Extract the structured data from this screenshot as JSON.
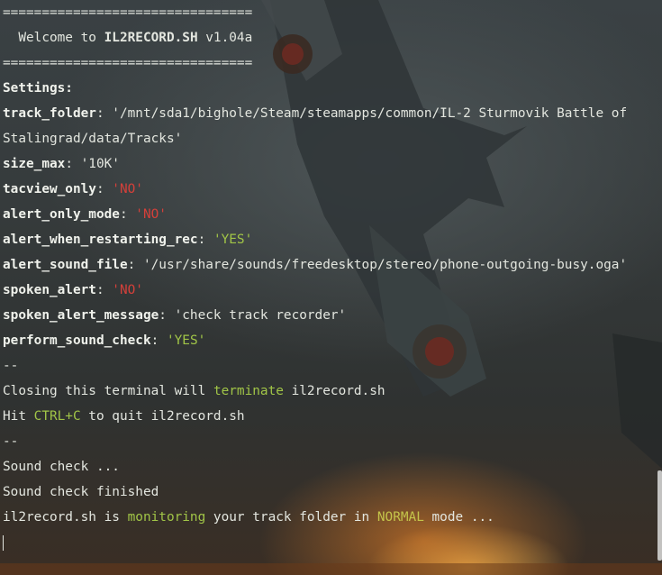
{
  "terminal": {
    "banner_rule": "================================",
    "welcome_prefix": "  Welcome to ",
    "welcome_name": "IL2RECORD.SH",
    "welcome_version": " v1.04a",
    "settings_heading": "Settings:",
    "settings": [
      {
        "key": "track_folder",
        "value": "'/mnt/sda1/bighole/Steam/steamapps/common/IL-2 Sturmovik Battle of Stalingrad/data/Tracks'",
        "style": "plain"
      },
      {
        "key": "size_max",
        "value": "'10K'",
        "style": "plain"
      },
      {
        "key": "tacview_only",
        "value": "'NO'",
        "style": "red"
      },
      {
        "key": "alert_only_mode",
        "value": "'NO'",
        "style": "red"
      },
      {
        "key": "alert_when_restarting_rec",
        "value": "'YES'",
        "style": "green"
      },
      {
        "key": "alert_sound_file",
        "value": "'/usr/share/sounds/freedesktop/stereo/phone-outgoing-busy.oga'",
        "style": "plain"
      },
      {
        "key": "spoken_alert",
        "value": "'NO'",
        "style": "red"
      },
      {
        "key": "spoken_alert_message",
        "value": "'check track recorder'",
        "style": "plain"
      },
      {
        "key": "perform_sound_check",
        "value": "'YES'",
        "style": "green"
      }
    ],
    "separator": "--",
    "closing_prefix": "Closing this terminal will ",
    "closing_word": "terminate",
    "closing_suffix": " il2record.sh",
    "hit_prefix": "Hit ",
    "hit_key": "CTRL+C",
    "hit_suffix": " to quit il2record.sh",
    "sound_check": "Sound check ...",
    "sound_check_finished": "Sound check finished",
    "monitor_prefix": "il2record.sh is ",
    "monitor_word": "monitoring",
    "monitor_middle": " your track folder in ",
    "monitor_mode": "NORMAL",
    "monitor_suffix": " mode ..."
  },
  "colors": {
    "text": "#e3e6df",
    "red_value": "#d4403a",
    "green_value": "#a1c547",
    "highlight": "#c4c44a"
  }
}
